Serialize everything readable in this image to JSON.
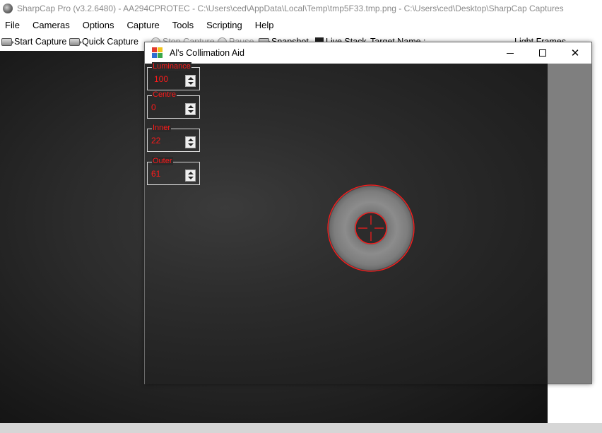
{
  "app": {
    "title": "SharpCap Pro (v3.2.6480) - AA294CPROTEC - C:\\Users\\ced\\AppData\\Local\\Temp\\tmp5F33.tmp.png - C:\\Users\\ced\\Desktop\\SharpCap Captures",
    "icon": "sharpcap-logo-icon"
  },
  "menu": {
    "items": [
      "File",
      "Cameras",
      "Options",
      "Capture",
      "Tools",
      "Scripting",
      "Help"
    ]
  },
  "toolbar": {
    "start_capture": "Start Capture",
    "quick_capture": "Quick Capture",
    "stop_capture": "Stop Capture",
    "pause": "Pause",
    "snapshot": "Snapshot",
    "live_stack": "Live Stack",
    "target_name": "Target Name :",
    "light_frames": "Light Frames"
  },
  "dialog": {
    "title": "Al's Collimation Aid",
    "label_color": "#ff1a1a",
    "controls": [
      {
        "label": "Luminance",
        "value": "100"
      },
      {
        "label": "Centre",
        "value": "0"
      },
      {
        "label": "Inner",
        "value": "22"
      },
      {
        "label": "Outer",
        "value": "61"
      }
    ]
  },
  "overlay": {
    "reticle_color": "#ff1a1a"
  }
}
